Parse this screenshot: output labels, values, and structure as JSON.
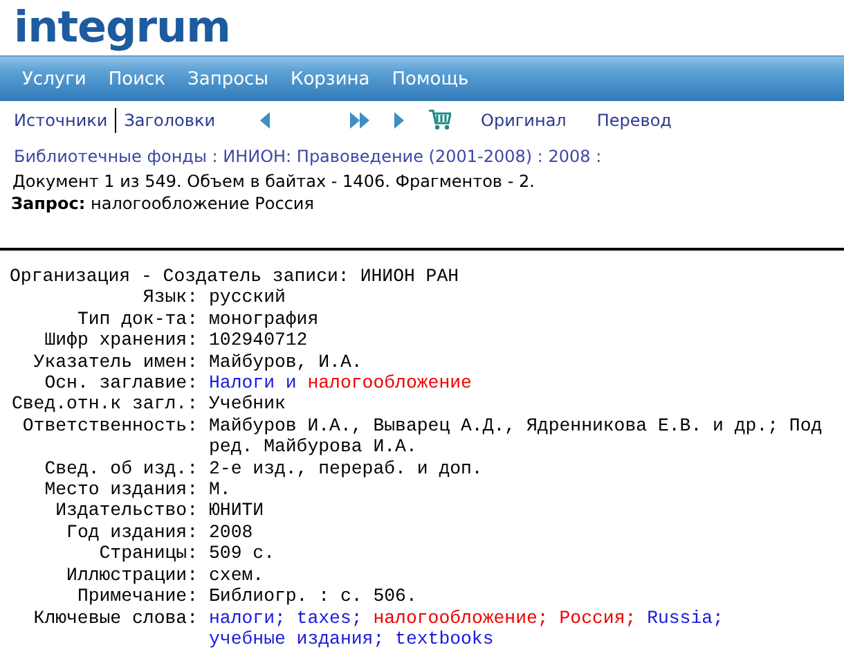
{
  "logo": "integrum",
  "menu": [
    {
      "label": "Услуги"
    },
    {
      "label": "Поиск"
    },
    {
      "label": "Запросы"
    },
    {
      "label": "Корзина"
    },
    {
      "label": "Помощь"
    }
  ],
  "toolbar": {
    "links": [
      {
        "label": "Источники"
      },
      {
        "label": "Заголовки"
      }
    ],
    "actions": [
      {
        "label": "Оригинал"
      },
      {
        "label": "Перевод"
      }
    ]
  },
  "breadcrumb": "Библиотечные фонды : ИНИОН: Правоведение (2001-2008) : 2008 :",
  "doc_info": "Документ 1 из 549. Объем в байтах - 1406. Фрагментов - 2.",
  "query": {
    "label": "Запрос:",
    "text": "налогообложение Россия"
  },
  "record": [
    {
      "label": "Организация - Создатель записи:",
      "wide": true,
      "lines": [
        [
          {
            "text": "ИНИОН РАН",
            "kind": "plain"
          }
        ]
      ]
    },
    {
      "label": "Язык:",
      "lines": [
        [
          {
            "text": "русский",
            "kind": "plain"
          }
        ]
      ]
    },
    {
      "label": "Тип док-та:",
      "lines": [
        [
          {
            "text": "монография",
            "kind": "plain"
          }
        ]
      ]
    },
    {
      "label": "Шифр хранения:",
      "lines": [
        [
          {
            "text": "102940712",
            "kind": "plain"
          }
        ]
      ]
    },
    {
      "label": "Указатель имен:",
      "lines": [
        [
          {
            "text": "Майбуров, И.А.",
            "kind": "plain"
          }
        ]
      ]
    },
    {
      "label": "Осн. заглавие:",
      "lines": [
        [
          {
            "text": "Налоги и ",
            "kind": "term"
          },
          {
            "text": "налогообложение",
            "kind": "hit"
          }
        ]
      ]
    },
    {
      "label": "Свед.отн.к загл.:",
      "lines": [
        [
          {
            "text": "Учебник",
            "kind": "plain"
          }
        ]
      ]
    },
    {
      "label": "Ответственность:",
      "lines": [
        [
          {
            "text": "Майбуров И.А., Выварец А.Д., Ядренникова Е.В. и др.; Под",
            "kind": "plain"
          }
        ],
        [
          {
            "text": "ред. Майбурова И.А.",
            "kind": "plain"
          }
        ]
      ]
    },
    {
      "label": "Свед. об изд.:",
      "lines": [
        [
          {
            "text": "2-е изд., перераб. и доп.",
            "kind": "plain"
          }
        ]
      ]
    },
    {
      "label": "Место издания:",
      "lines": [
        [
          {
            "text": "М.",
            "kind": "plain"
          }
        ]
      ]
    },
    {
      "label": "Издательство:",
      "lines": [
        [
          {
            "text": "ЮНИТИ",
            "kind": "plain"
          }
        ]
      ]
    },
    {
      "label": "Год издания:",
      "lines": [
        [
          {
            "text": "2008",
            "kind": "plain"
          }
        ]
      ]
    },
    {
      "label": "Страницы:",
      "lines": [
        [
          {
            "text": "509 с.",
            "kind": "plain"
          }
        ]
      ]
    },
    {
      "label": "Иллюстрации:",
      "lines": [
        [
          {
            "text": "схем.",
            "kind": "plain"
          }
        ]
      ]
    },
    {
      "label": "Примечание:",
      "lines": [
        [
          {
            "text": "Библиогр. : с. 506.",
            "kind": "plain"
          }
        ]
      ]
    },
    {
      "label": "Ключевые слова:",
      "lines": [
        [
          {
            "text": "налоги; taxes; ",
            "kind": "term"
          },
          {
            "text": "налогообложение; Россия;",
            "kind": "hit"
          },
          {
            "text": " Russia;",
            "kind": "term"
          }
        ],
        [
          {
            "text": "учебные издания; textbooks",
            "kind": "term"
          }
        ]
      ]
    }
  ]
}
